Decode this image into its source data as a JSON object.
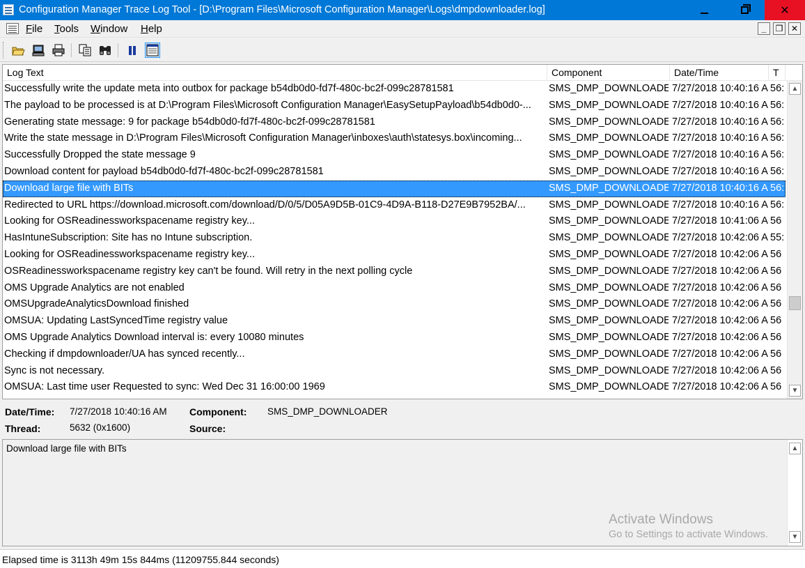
{
  "window": {
    "title": "Configuration Manager Trace Log Tool - [D:\\Program Files\\Microsoft Configuration Manager\\Logs\\dmpdownloader.log]"
  },
  "menu": {
    "file": "File",
    "tools": "Tools",
    "window": "Window",
    "help": "Help",
    "mdi_minimize": "_",
    "mdi_restore": "❐",
    "mdi_close": "✕"
  },
  "toolbar": {
    "buttons": [
      "open-icon",
      "open-remote-icon",
      "print-icon",
      "copy-icon",
      "find-icon",
      "pause-icon",
      "preview-pane-icon"
    ]
  },
  "columns": {
    "log_text": "Log Text",
    "component": "Component",
    "datetime": "Date/Time",
    "thread": "T"
  },
  "rows": [
    {
      "text": "Successfully write the update meta into outbox for package b54db0d0-fd7f-480c-bc2f-099c28781581",
      "component": "SMS_DMP_DOWNLOADEI",
      "datetime": "7/27/2018 10:40:16 A",
      "thread": "56:"
    },
    {
      "text": "The payload to be processed is at D:\\Program Files\\Microsoft Configuration Manager\\EasySetupPayload\\b54db0d0-...",
      "component": "SMS_DMP_DOWNLOADEI",
      "datetime": "7/27/2018 10:40:16 A",
      "thread": "56:"
    },
    {
      "text": "Generating state message: 9 for package b54db0d0-fd7f-480c-bc2f-099c28781581",
      "component": "SMS_DMP_DOWNLOADEI",
      "datetime": "7/27/2018 10:40:16 A",
      "thread": "56:"
    },
    {
      "text": "Write the state message in D:\\Program Files\\Microsoft Configuration Manager\\inboxes\\auth\\statesys.box\\incoming...",
      "component": "SMS_DMP_DOWNLOADEI",
      "datetime": "7/27/2018 10:40:16 A",
      "thread": "56:"
    },
    {
      "text": "Successfully Dropped the state message 9",
      "component": "SMS_DMP_DOWNLOADEI",
      "datetime": "7/27/2018 10:40:16 A",
      "thread": "56:"
    },
    {
      "text": "Download content for payload b54db0d0-fd7f-480c-bc2f-099c28781581",
      "component": "SMS_DMP_DOWNLOADEI",
      "datetime": "7/27/2018 10:40:16 A",
      "thread": "56:"
    },
    {
      "text": "Download large file with BITs",
      "component": "SMS_DMP_DOWNLOADEI",
      "datetime": "7/27/2018 10:40:16 A",
      "thread": "56:"
    },
    {
      "text": "Redirected to URL https://download.microsoft.com/download/D/0/5/D05A9D5B-01C9-4D9A-B118-D27E9B7952BA/...",
      "component": "SMS_DMP_DOWNLOADEI",
      "datetime": "7/27/2018 10:40:16 A",
      "thread": "56:"
    },
    {
      "text": "Looking for OSReadinessworkspacename registry key...",
      "component": "SMS_DMP_DOWNLOADEI",
      "datetime": "7/27/2018 10:41:06 A",
      "thread": "56"
    },
    {
      "text": "HasIntuneSubscription: Site has no Intune subscription.",
      "component": "SMS_DMP_DOWNLOADEI",
      "datetime": "7/27/2018 10:42:06 A",
      "thread": "55:"
    },
    {
      "text": "Looking for OSReadinessworkspacename registry key...",
      "component": "SMS_DMP_DOWNLOADEI",
      "datetime": "7/27/2018 10:42:06 A",
      "thread": "56"
    },
    {
      "text": "OSReadinessworkspacename registry key can't be found. Will retry in the next polling cycle",
      "component": "SMS_DMP_DOWNLOADEI",
      "datetime": "7/27/2018 10:42:06 A",
      "thread": "56"
    },
    {
      "text": "OMS Upgrade Analytics are not enabled",
      "component": "SMS_DMP_DOWNLOADEI",
      "datetime": "7/27/2018 10:42:06 A",
      "thread": "56"
    },
    {
      "text": "OMSUpgradeAnalyticsDownload finished",
      "component": "SMS_DMP_DOWNLOADEI",
      "datetime": "7/27/2018 10:42:06 A",
      "thread": "56"
    },
    {
      "text": "OMSUA: Updating LastSyncedTime registry value",
      "component": "SMS_DMP_DOWNLOADEI",
      "datetime": "7/27/2018 10:42:06 A",
      "thread": "56"
    },
    {
      "text": "OMS Upgrade Analytics Download interval is: every 10080 minutes",
      "component": "SMS_DMP_DOWNLOADEI",
      "datetime": "7/27/2018 10:42:06 A",
      "thread": "56"
    },
    {
      "text": "Checking if dmpdownloader/UA has synced recently...",
      "component": "SMS_DMP_DOWNLOADEI",
      "datetime": "7/27/2018 10:42:06 A",
      "thread": "56"
    },
    {
      "text": "Sync is not necessary.",
      "component": "SMS_DMP_DOWNLOADEI",
      "datetime": "7/27/2018 10:42:06 A",
      "thread": "56"
    },
    {
      "text": "OMSUA: Last time user Requested to sync: Wed Dec 31 16:00:00 1969",
      "component": "SMS_DMP_DOWNLOADEI",
      "datetime": "7/27/2018 10:42:06 A",
      "thread": "56"
    }
  ],
  "selected_row": 6,
  "details": {
    "datetime_label": "Date/Time:",
    "datetime_value": "7/27/2018 10:40:16 AM",
    "component_label": "Component:",
    "component_value": "SMS_DMP_DOWNLOADER",
    "thread_label": "Thread:",
    "thread_value": "5632 (0x1600)",
    "source_label": "Source:",
    "source_value": ""
  },
  "message": {
    "text": "Download large file with BITs"
  },
  "watermark": {
    "line1": "Activate Windows",
    "line2": "Go to Settings to activate Windows."
  },
  "status": {
    "text": "Elapsed time is 3113h 49m 15s 844ms (11209755.844 seconds)"
  },
  "colors": {
    "titlebar": "#0078d7",
    "selection": "#3399ff",
    "close_button": "#e81123"
  }
}
